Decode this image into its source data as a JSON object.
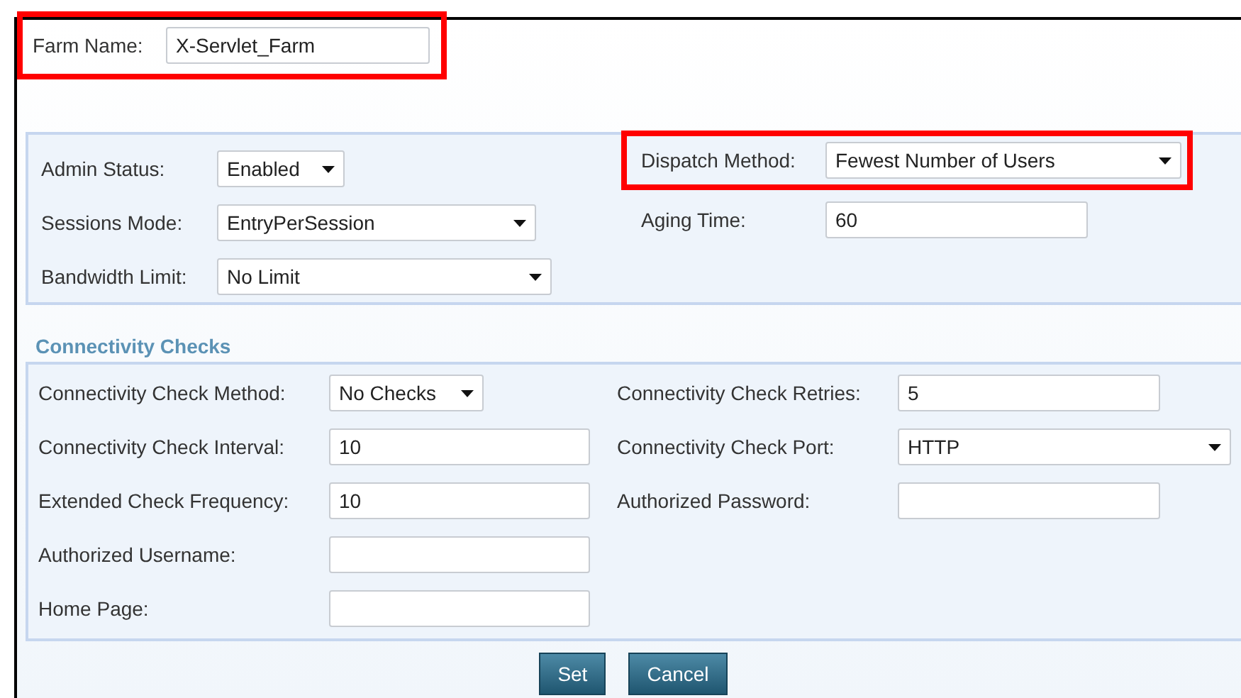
{
  "farm_name": {
    "label": "Farm Name:",
    "value": "X-Servlet_Farm",
    "highlighted": true
  },
  "general": {
    "left": [
      {
        "kind": "select",
        "label": "Admin Status:",
        "value": "Enabled",
        "highlighted": false
      },
      {
        "kind": "select",
        "label": "Sessions Mode:",
        "value": "EntryPerSession",
        "highlighted": false
      },
      {
        "kind": "select",
        "label": "Bandwidth Limit:",
        "value": "No Limit",
        "highlighted": false
      }
    ],
    "right": [
      {
        "kind": "select",
        "label": "Dispatch Method:",
        "value": "Fewest Number of Users",
        "highlighted": true
      },
      {
        "kind": "input",
        "label": "Aging Time:",
        "value": "60",
        "highlighted": false
      }
    ]
  },
  "connectivity": {
    "title": "Connectivity Checks",
    "left": [
      {
        "kind": "select",
        "label": "Connectivity Check Method:",
        "value": "No Checks",
        "highlighted": false
      },
      {
        "kind": "input",
        "label": "Connectivity Check Interval:",
        "value": "10",
        "highlighted": false
      },
      {
        "kind": "input",
        "label": "Extended Check Frequency:",
        "value": "10",
        "highlighted": false
      },
      {
        "kind": "input",
        "label": "Authorized Username:",
        "highlighted": false
      },
      {
        "kind": "input",
        "label": "Home Page:",
        "highlighted": false
      }
    ],
    "right": [
      {
        "kind": "input",
        "label": "Connectivity Check Retries:",
        "value": "5",
        "highlighted": false
      },
      {
        "kind": "select",
        "label": "Connectivity Check Port:",
        "value": "HTTP",
        "highlighted": false
      },
      {
        "kind": "input",
        "label": "Authorized Password:",
        "highlighted": false
      }
    ]
  },
  "buttons": [
    {
      "label": "Set"
    },
    {
      "label": "Cancel"
    }
  ]
}
